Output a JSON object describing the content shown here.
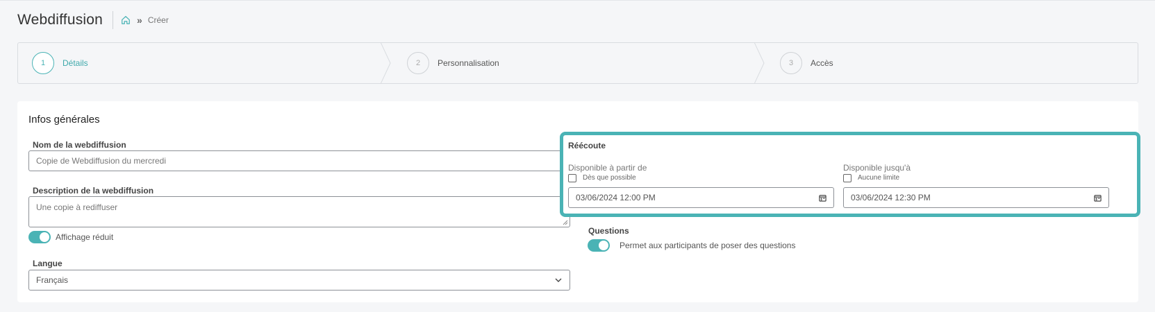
{
  "header": {
    "title": "Webdiffusion",
    "breadcrumb_separator": "»",
    "breadcrumb_current": "Créer"
  },
  "stepper": {
    "steps": [
      {
        "number": "1",
        "label": "Détails",
        "active": true
      },
      {
        "number": "2",
        "label": "Personnalisation",
        "active": false
      },
      {
        "number": "3",
        "label": "Accès",
        "active": false
      }
    ]
  },
  "general": {
    "section_title": "Infos générales",
    "name_label": "Nom de la webdiffusion",
    "name_value": "Copie de Webdiffusion du mercredi",
    "description_label": "Description de la webdiffusion",
    "description_value": "Une copie à rediffuser",
    "reduced_display_label": "Affichage réduit",
    "language_label": "Langue",
    "language_value": "Français"
  },
  "replay": {
    "title": "Réécoute",
    "from_label": "Disponible à partir de",
    "from_checkbox_label": "Dès que possible",
    "from_value": "03/06/2024 12:00 PM",
    "until_label": "Disponible jusqu'à",
    "until_checkbox_label": "Aucune limite",
    "until_value": "03/06/2024 12:30 PM"
  },
  "questions": {
    "title": "Questions",
    "toggle_label": "Permet aux participants de poser des questions"
  },
  "colors": {
    "accent": "#4ab3b5"
  },
  "icons": {
    "home": "home-icon",
    "calendar": "calendar-icon",
    "chevron_down": "chevron-down-icon"
  }
}
